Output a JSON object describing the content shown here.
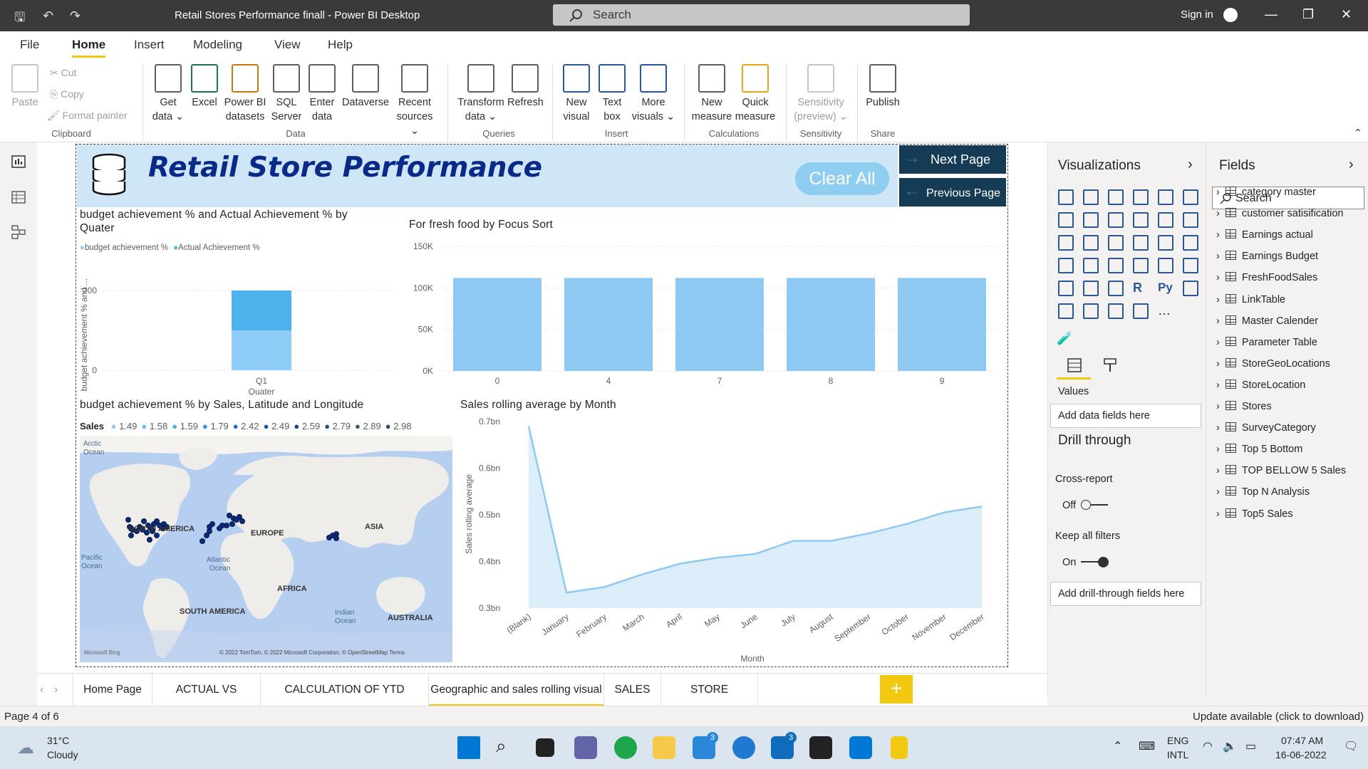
{
  "app": {
    "title": "Retail Stores Performance finall - Power BI Desktop",
    "search_placeholder": "Search",
    "signin": "Sign in"
  },
  "menu": [
    "File",
    "Home",
    "Insert",
    "Modeling",
    "View",
    "Help"
  ],
  "ribbon": {
    "clipboard": {
      "paste": "Paste",
      "cut": "Cut",
      "copy": "Copy",
      "format_painter": "Format painter",
      "group": "Clipboard"
    },
    "data": {
      "get_data": "Get",
      "get_data2": "data",
      "excel": "Excel",
      "pbi1": "Power BI",
      "pbi2": "datasets",
      "sql1": "SQL",
      "sql2": "Server",
      "enter1": "Enter",
      "enter2": "data",
      "dataverse": "Dataverse",
      "recent1": "Recent",
      "recent2": "sources",
      "group": "Data"
    },
    "queries": {
      "transform1": "Transform",
      "transform2": "data",
      "refresh": "Refresh",
      "group": "Queries"
    },
    "insert": {
      "newvis1": "New",
      "newvis2": "visual",
      "text1": "Text",
      "text2": "box",
      "more1": "More",
      "more2": "visuals",
      "group": "Insert"
    },
    "calc": {
      "newm1": "New",
      "newm2": "measure",
      "quick1": "Quick",
      "quick2": "measure",
      "group": "Calculations"
    },
    "sens": {
      "s1": "Sensitivity",
      "s2": "(preview)",
      "group": "Sensitivity"
    },
    "share": {
      "publish": "Publish",
      "group": "Share"
    }
  },
  "report": {
    "title": "Retail Store Performance",
    "clear_all": "Clear All",
    "next_page": "Next Page",
    "previous_page": "Previous Page"
  },
  "visual1": {
    "title1": "budget achievement % and Actual Achievement % by",
    "title2": "Quater",
    "legend": [
      "budget achievement %",
      "Actual Achievement %"
    ],
    "ylabel": "budget achievement % and ...",
    "xlabel": "Quater",
    "yticks": [
      "200",
      "0"
    ],
    "xcat": "Q1"
  },
  "visual2": {
    "title": "For fresh food by Focus Sort"
  },
  "visual3": {
    "title": "budget achievement % by Sales, Latitude and Longitude",
    "legend_label": "Sales",
    "legend_values": [
      "1.49",
      "1.58",
      "1.59",
      "1.79",
      "2.42",
      "2.49",
      "2.59",
      "2.79",
      "2.89",
      "2.98"
    ],
    "map_labels": {
      "arctic1": "Arctic",
      "arctic2": "Ocean",
      "na": "NORTH AMERICA",
      "eu": "EUROPE",
      "asia": "ASIA",
      "pac1": "Pacific",
      "pac2": "Ocean",
      "atl1": "Atlantic",
      "atl2": "Ocean",
      "africa": "AFRICA",
      "sa": "SOUTH AMERICA",
      "ind1": "Indian",
      "ind2": "Ocean",
      "aus": "AUSTRALIA",
      "bing": "Microsoft Bing",
      "copyright": "© 2022 TomTom, © 2022 Microsoft Corporation, © OpenStreetMap  Terms"
    }
  },
  "visual4": {
    "title": "Sales rolling average by Month",
    "ylabel": "Sales rolling average",
    "xlabel": "Month"
  },
  "chart_data": [
    {
      "type": "bar",
      "title": "For fresh food by Focus Sort",
      "categories": [
        "0",
        "4",
        "7",
        "8",
        "9"
      ],
      "values": [
        112000,
        112000,
        112000,
        112000,
        112000
      ],
      "ylim": [
        0,
        150000
      ],
      "yticks": [
        "0K",
        "50K",
        "100K",
        "150K"
      ],
      "grid": true
    },
    {
      "type": "bar",
      "title": "budget achievement % and Actual Achievement % by Quater",
      "categories": [
        "Q1"
      ],
      "series": [
        {
          "name": "budget achievement %",
          "values": [
            100
          ]
        },
        {
          "name": "Actual Achievement %",
          "values": [
            100
          ]
        }
      ],
      "stacked": true,
      "ylim": [
        0,
        250
      ],
      "color": [
        "#8ecdf7",
        "#4eb3ec"
      ]
    },
    {
      "type": "area",
      "title": "Sales rolling average by Month",
      "categories": [
        "(Blank)",
        "January",
        "February",
        "March",
        "April",
        "May",
        "June",
        "July",
        "August",
        "September",
        "October",
        "November",
        "December"
      ],
      "values": [
        0.69,
        0.333,
        0.345,
        0.372,
        0.395,
        0.408,
        0.416,
        0.444,
        0.444,
        0.46,
        0.48,
        0.505,
        0.518
      ],
      "ylim": [
        0.3,
        0.7
      ],
      "yticks": [
        "0.3bn",
        "0.4bn",
        "0.5bn",
        "0.6bn",
        "0.7bn"
      ],
      "ylabel": "Sales rolling average",
      "xlabel": "Month"
    }
  ],
  "viz_pane": {
    "title": "Visualizations",
    "values_label": "Values",
    "add_data": "Add data fields here",
    "drill_title": "Drill through",
    "cross_report": "Cross-report",
    "off": "Off",
    "keep_filters": "Keep all filters",
    "on": "On",
    "add_drill": "Add drill-through fields here"
  },
  "fields_pane": {
    "title": "Fields",
    "search": "Search",
    "tables": [
      "category master",
      "customer satisification",
      "Earnings actual",
      "Earnings Budget",
      "FreshFoodSales",
      "LinkTable",
      "Master Calender",
      "Parameter Table",
      "StoreGeoLocations",
      "StoreLocation",
      "Stores",
      "SurveyCategory",
      "Top 5 Bottom",
      "TOP BELLOW 5 Sales",
      "Top N Analysis",
      "Top5 Sales"
    ]
  },
  "tabs": [
    "Home Page",
    "ACTUAL VS BUDGET",
    "CALCULATION OF YTD ,MTD,QTD",
    "Geographic and sales rolling visual",
    "SALES",
    "STORE MANAGER"
  ],
  "status": {
    "page": "Page 4 of 6",
    "update": "Update available (click to download)"
  },
  "taskbar": {
    "temp": "31°C",
    "weather": "Cloudy",
    "lang1": "ENG",
    "lang2": "INTL",
    "time": "07:47 AM",
    "date": "16-06-2022",
    "badge1": "3",
    "badge2": "3"
  },
  "colors": {
    "accent": "#f2c811",
    "bar": "#8ec9f4",
    "title_blue": "#0a2a8a",
    "nav_dark": "#163b55"
  }
}
